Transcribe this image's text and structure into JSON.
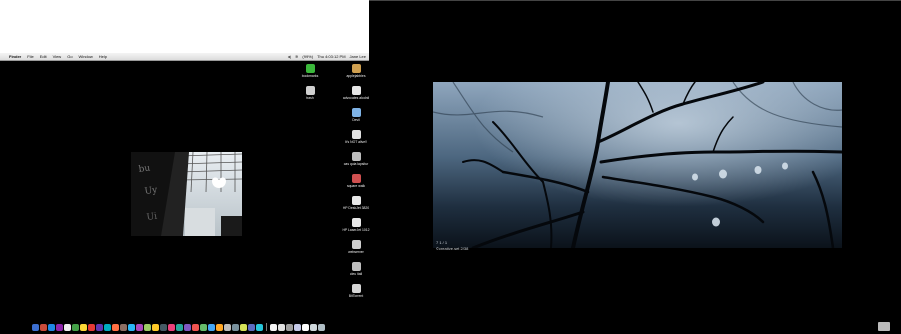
{
  "menubar": {
    "apple_icon": "",
    "app_name": "Finder",
    "menus": [
      "File",
      "Edit",
      "View",
      "Go",
      "Window",
      "Help"
    ],
    "status": {
      "battery": "(99%)",
      "clock": "Thu 4:03:12 PM",
      "user": "Jane Lee"
    }
  },
  "desktop_icons": [
    {
      "label": "bookmarks",
      "icon": "green-bookmarks-icon",
      "color": "#3bb83b"
    },
    {
      "label": "applejabbies",
      "icon": "app-icon",
      "color": "#d0a050"
    },
    {
      "label": "trash",
      "icon": "trash-icon",
      "color": "#cfcfcf"
    },
    {
      "label": "advocates alodnil",
      "icon": "document-icon",
      "color": "#e6e6e6"
    },
    {
      "label": "Devil",
      "icon": "file-icon",
      "color": "#7fb3e6"
    },
    {
      "label": "It's NOT alive!!",
      "icon": "document-icon",
      "color": "#e0e0e0"
    },
    {
      "label": "cas quia lapsitur",
      "icon": "document-icon",
      "color": "#bdbdbd"
    },
    {
      "label": "square walk",
      "icon": "app-icon",
      "color": "#d05050"
    },
    {
      "label": "HP DeskJet 3820",
      "icon": "printer-icon",
      "color": "#e8e8e8"
    },
    {
      "label": "HP LaserJet 1012",
      "icon": "printer-icon",
      "color": "#e8e8e8"
    },
    {
      "label": "webserver",
      "icon": "drive-icon",
      "color": "#cfcfcf"
    },
    {
      "label": "cleu itall",
      "icon": "drive-icon",
      "color": "#bfbfbf"
    },
    {
      "label": "BitTorrent",
      "icon": "folder-icon",
      "color": "#d6d6d6"
    }
  ],
  "dock_colors": [
    "#3c6fd1",
    "#c94b3a",
    "#1e88e5",
    "#8e24aa",
    "#f0f0f0",
    "#43a047",
    "#fdd835",
    "#e53935",
    "#5e35b1",
    "#00acc1",
    "#ff7043",
    "#8d6e63",
    "#29b6f6",
    "#ab47bc",
    "#9ccc65",
    "#ffca28",
    "#455a64",
    "#ec407a",
    "#26a69a",
    "#7e57c2",
    "#ef5350",
    "#66bb6a",
    "#42a5f5",
    "#ffa726",
    "#bdbdbd",
    "#78909c",
    "#d4e157",
    "#5c6bc0",
    "#26c6da",
    "#f5f5f5",
    "#e0e0e0",
    "#9e9e9e",
    "#c5cae9",
    "#ffffff",
    "#cfd8dc",
    "#b0bec5"
  ],
  "wallpaper": {
    "caption_line1": "7 1 / 1",
    "caption_line2": "©creative.set 2/38"
  }
}
